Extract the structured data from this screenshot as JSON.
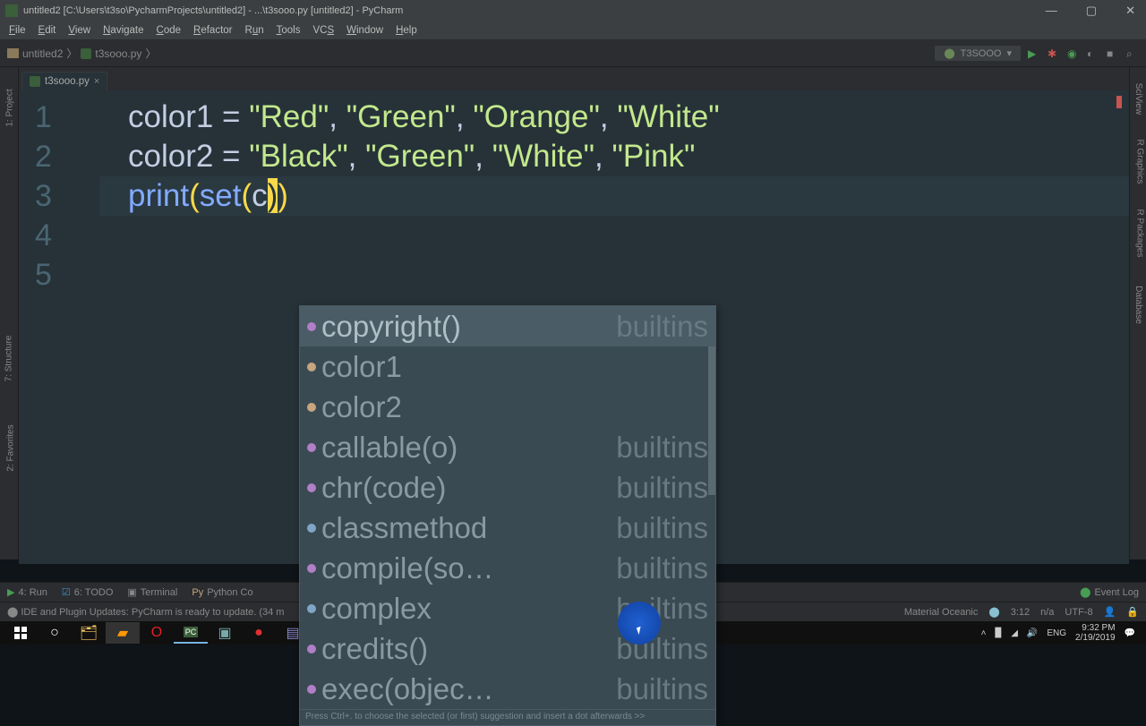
{
  "window": {
    "title": "untitled2 [C:\\Users\\t3so\\PycharmProjects\\untitled2] - ...\\t3sooo.py [untitled2] - PyCharm"
  },
  "menu": [
    "File",
    "Edit",
    "View",
    "Navigate",
    "Code",
    "Refactor",
    "Run",
    "Tools",
    "VCS",
    "Window",
    "Help"
  ],
  "breadcrumb": {
    "project": "untitled2",
    "file": "t3sooo.py"
  },
  "run_config": "T3SOOO",
  "tab": {
    "name": "t3sooo.py"
  },
  "left_tools": [
    "1: Project",
    "7: Structure",
    "2: Favorites"
  ],
  "right_tools": [
    "SciView",
    "R Graphics",
    "R Packages",
    "Database"
  ],
  "code": {
    "lines": [
      "1",
      "2",
      "3",
      "4",
      "5"
    ],
    "l1_var": "color1",
    "l1_eq": " = ",
    "l1_s1": "\"Red\"",
    "l1_c": ", ",
    "l1_s2": "\"Green\"",
    "l1_s3": "\"Orange\"",
    "l1_s4": "\"White\"",
    "l2_var": "color2",
    "l2_s1": "\"Black\"",
    "l2_s2": "\"Green\"",
    "l2_s3": "\"White\"",
    "l2_s4": "\"Pink\"",
    "l3_print": "print",
    "l3_set": "set",
    "l3_c": "c",
    "l3_paren1": "(",
    "l3_paren2": ")",
    "l3_paren3": ")"
  },
  "autocomplete": {
    "hint": "Press Ctrl+. to choose the selected (or first) suggestion and insert a dot afterwards  >>",
    "items": [
      {
        "ic": "f",
        "label": "copyright()",
        "src": "builtins",
        "sel": true
      },
      {
        "ic": "v",
        "label": "color1",
        "src": ""
      },
      {
        "ic": "v",
        "label": "color2",
        "src": ""
      },
      {
        "ic": "f",
        "label": "callable(o)",
        "src": "builtins"
      },
      {
        "ic": "f",
        "label": "chr(code)",
        "src": "builtins"
      },
      {
        "ic": "c",
        "label": "classmethod",
        "src": "builtins"
      },
      {
        "ic": "f",
        "label": "compile(so…",
        "src": "builtins"
      },
      {
        "ic": "c",
        "label": "complex",
        "src": "builtins"
      },
      {
        "ic": "f",
        "label": "credits()",
        "src": "builtins"
      },
      {
        "ic": "f",
        "label": "exec(objec…",
        "src": "builtins"
      }
    ]
  },
  "bottom": {
    "run": "4: Run",
    "todo": "6: TODO",
    "terminal": "Terminal",
    "pycons": "Python Co",
    "eventlog": "Event Log"
  },
  "status": {
    "update": "IDE and Plugin Updates: PyCharm is ready to update. (34 m",
    "theme": "Material Oceanic",
    "pos": "3:12",
    "sel": "n/a",
    "enc": "UTF-8",
    "insp": "⬤"
  },
  "taskbar": {
    "lang": "ENG",
    "time": "9:32 PM",
    "date": "2/19/2019"
  }
}
